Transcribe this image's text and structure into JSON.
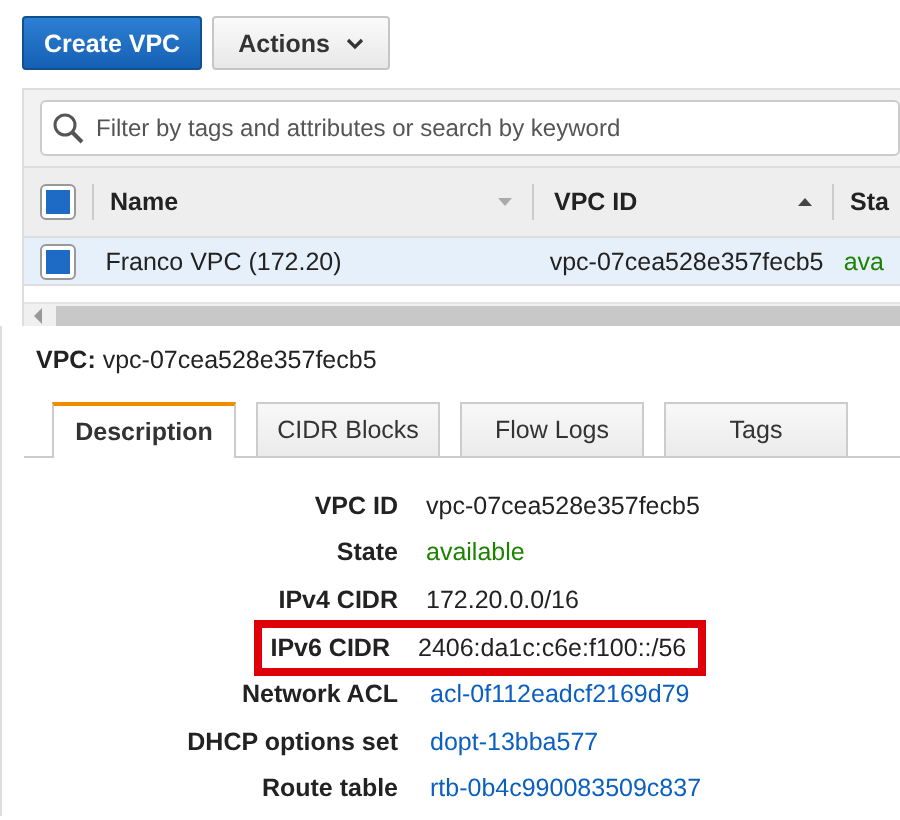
{
  "toolbar": {
    "create_button": "Create VPC",
    "actions_button": "Actions"
  },
  "search": {
    "placeholder": "Filter by tags and attributes or search by keyword"
  },
  "table": {
    "header_checked": true,
    "columns": [
      {
        "label": "Name",
        "sorted": false
      },
      {
        "label": "VPC ID",
        "sorted": true
      },
      {
        "label": "Sta"
      }
    ],
    "rows": [
      {
        "checked": true,
        "selected": true,
        "cells": [
          "Franco VPC (172.20)",
          "vpc-07cea528e357fecb5",
          "ava"
        ]
      }
    ]
  },
  "detail": {
    "label": "VPC:",
    "value": "vpc-07cea528e357fecb5"
  },
  "tabs": [
    {
      "label": "Description",
      "selected": true
    },
    {
      "label": "CIDR Blocks",
      "selected": false
    },
    {
      "label": "Flow Logs",
      "selected": false
    },
    {
      "label": "Tags",
      "selected": false
    }
  ],
  "fields": [
    {
      "label": "VPC ID",
      "value": "vpc-07cea528e357fecb5",
      "kind": "plain",
      "highlighted": false
    },
    {
      "label": "State",
      "value": "available",
      "kind": "status",
      "highlighted": false
    },
    {
      "label": "IPv4 CIDR",
      "value": "172.20.0.0/16",
      "kind": "plain",
      "highlighted": false
    },
    {
      "label": "IPv6 CIDR",
      "value": "2406:da1c:c6e:f100::/56",
      "kind": "plain",
      "highlighted": true
    },
    {
      "label": "Network ACL",
      "value": "acl-0f112eadcf2169d79",
      "kind": "link",
      "highlighted": false
    },
    {
      "label": "DHCP options set",
      "value": "dopt-13bba577",
      "kind": "link",
      "highlighted": false
    },
    {
      "label": "Route table",
      "value": "rtb-0b4c990083509c837",
      "kind": "link",
      "highlighted": false
    }
  ]
}
